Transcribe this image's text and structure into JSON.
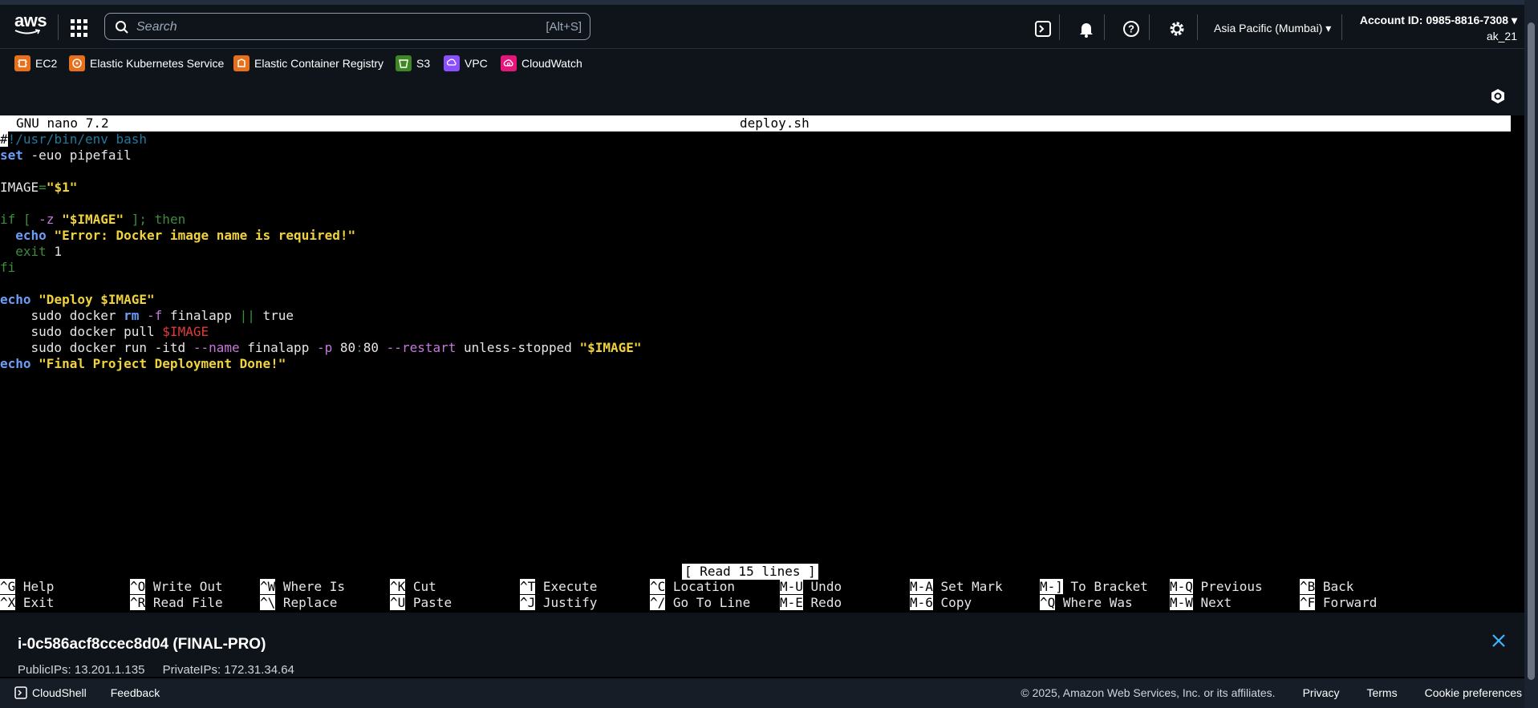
{
  "topbar": {
    "logo_text": "aws",
    "search_placeholder": "Search",
    "search_shortcut": "[Alt+S]",
    "region": "Asia Pacific (Mumbai) ▾",
    "account_id": "Account ID: 0985-8816-7308 ▾",
    "username": "ak_21"
  },
  "favorites": [
    {
      "label": "EC2",
      "color": "#e8701a",
      "icon": "ec2-icon"
    },
    {
      "label": "Elastic Kubernetes Service",
      "color": "#e8701a",
      "icon": "eks-icon"
    },
    {
      "label": "Elastic Container Registry",
      "color": "#e8701a",
      "icon": "ecr-icon"
    },
    {
      "label": "S3",
      "color": "#3f8624",
      "icon": "s3-icon"
    },
    {
      "label": "VPC",
      "color": "#8c4fff",
      "icon": "vpc-icon"
    },
    {
      "label": "CloudWatch",
      "color": "#e7157b",
      "icon": "cloudwatch-icon"
    }
  ],
  "nano": {
    "version": "GNU nano 7.2",
    "filename": "deploy.sh",
    "status": "[ Read 15 lines ]",
    "shortcuts_row1": [
      {
        "key": "^G",
        "label": "Help"
      },
      {
        "key": "^O",
        "label": "Write Out"
      },
      {
        "key": "^W",
        "label": "Where Is"
      },
      {
        "key": "^K",
        "label": "Cut"
      },
      {
        "key": "^T",
        "label": "Execute"
      },
      {
        "key": "^C",
        "label": "Location"
      },
      {
        "key": "M-U",
        "label": "Undo"
      },
      {
        "key": "M-A",
        "label": "Set Mark"
      },
      {
        "key": "M-]",
        "label": "To Bracket"
      },
      {
        "key": "M-Q",
        "label": "Previous"
      },
      {
        "key": "^B",
        "label": "Back"
      }
    ],
    "shortcuts_row2": [
      {
        "key": "^X",
        "label": "Exit"
      },
      {
        "key": "^R",
        "label": "Read File"
      },
      {
        "key": "^\\",
        "label": "Replace"
      },
      {
        "key": "^U",
        "label": "Paste"
      },
      {
        "key": "^J",
        "label": "Justify"
      },
      {
        "key": "^/",
        "label": "Go To Line"
      },
      {
        "key": "M-E",
        "label": "Redo"
      },
      {
        "key": "M-6",
        "label": "Copy"
      },
      {
        "key": "^Q",
        "label": "Where Was"
      },
      {
        "key": "M-W",
        "label": "Next"
      },
      {
        "key": "^F",
        "label": "Forward"
      }
    ],
    "code_lines": [
      [
        {
          "t": "#",
          "c": "cursor"
        },
        {
          "t": "!/usr/bin/env bash",
          "c": "cmt"
        }
      ],
      [
        {
          "t": "set",
          "c": "kw"
        },
        {
          "t": " -euo pipefail",
          "c": "ws"
        }
      ],
      [],
      [
        {
          "t": "IMAGE",
          "c": "ws"
        },
        {
          "t": "=",
          "c": "grn"
        },
        {
          "t": "\"$1\"",
          "c": "str"
        }
      ],
      [],
      [
        {
          "t": "if [ ",
          "c": "grn"
        },
        {
          "t": "-z",
          "c": "pur"
        },
        {
          "t": " ",
          "c": "ws"
        },
        {
          "t": "\"$IMAGE\"",
          "c": "str"
        },
        {
          "t": " ]; then",
          "c": "grn"
        }
      ],
      [
        {
          "t": "  ",
          "c": "ws"
        },
        {
          "t": "echo",
          "c": "kw"
        },
        {
          "t": " ",
          "c": "ws"
        },
        {
          "t": "\"Error: Docker image name is required!\"",
          "c": "str"
        }
      ],
      [
        {
          "t": "  exit",
          "c": "grn"
        },
        {
          "t": " 1",
          "c": "ws"
        }
      ],
      [
        {
          "t": "fi",
          "c": "grn"
        }
      ],
      [],
      [
        {
          "t": "echo",
          "c": "kw"
        },
        {
          "t": " ",
          "c": "ws"
        },
        {
          "t": "\"Deploy $IMAGE\"",
          "c": "str"
        }
      ],
      [
        {
          "t": "    sudo docker ",
          "c": "ws"
        },
        {
          "t": "rm",
          "c": "kw"
        },
        {
          "t": " ",
          "c": "ws"
        },
        {
          "t": "-f",
          "c": "pur"
        },
        {
          "t": " finalapp ",
          "c": "ws"
        },
        {
          "t": "||",
          "c": "grn"
        },
        {
          "t": " true",
          "c": "ws"
        }
      ],
      [
        {
          "t": "    sudo docker pull ",
          "c": "ws"
        },
        {
          "t": "$IMAGE",
          "c": "red"
        }
      ],
      [
        {
          "t": "    sudo docker run -itd ",
          "c": "ws"
        },
        {
          "t": "--name",
          "c": "pur"
        },
        {
          "t": " finalapp ",
          "c": "ws"
        },
        {
          "t": "-p",
          "c": "pur"
        },
        {
          "t": " 80",
          "c": "ws"
        },
        {
          "t": ":",
          "c": "grn"
        },
        {
          "t": "80 ",
          "c": "ws"
        },
        {
          "t": "--restart",
          "c": "pur"
        },
        {
          "t": " unless-stopped ",
          "c": "ws"
        },
        {
          "t": "\"$IMAGE\"",
          "c": "str"
        }
      ],
      [
        {
          "t": "echo",
          "c": "kw"
        },
        {
          "t": " ",
          "c": "ws"
        },
        {
          "t": "\"Final Project Deployment Done!\"",
          "c": "str"
        }
      ]
    ]
  },
  "instance": {
    "title": "i-0c586acf8ccec8d04 (FINAL-PRO)",
    "public_ips": "PublicIPs: 13.201.1.135",
    "private_ips": "PrivateIPs: 172.31.34.64"
  },
  "footer": {
    "cloudshell": "CloudShell",
    "feedback": "Feedback",
    "copyright": "© 2025, Amazon Web Services, Inc. or its affiliates.",
    "privacy": "Privacy",
    "terms": "Terms",
    "cookies": "Cookie preferences"
  }
}
